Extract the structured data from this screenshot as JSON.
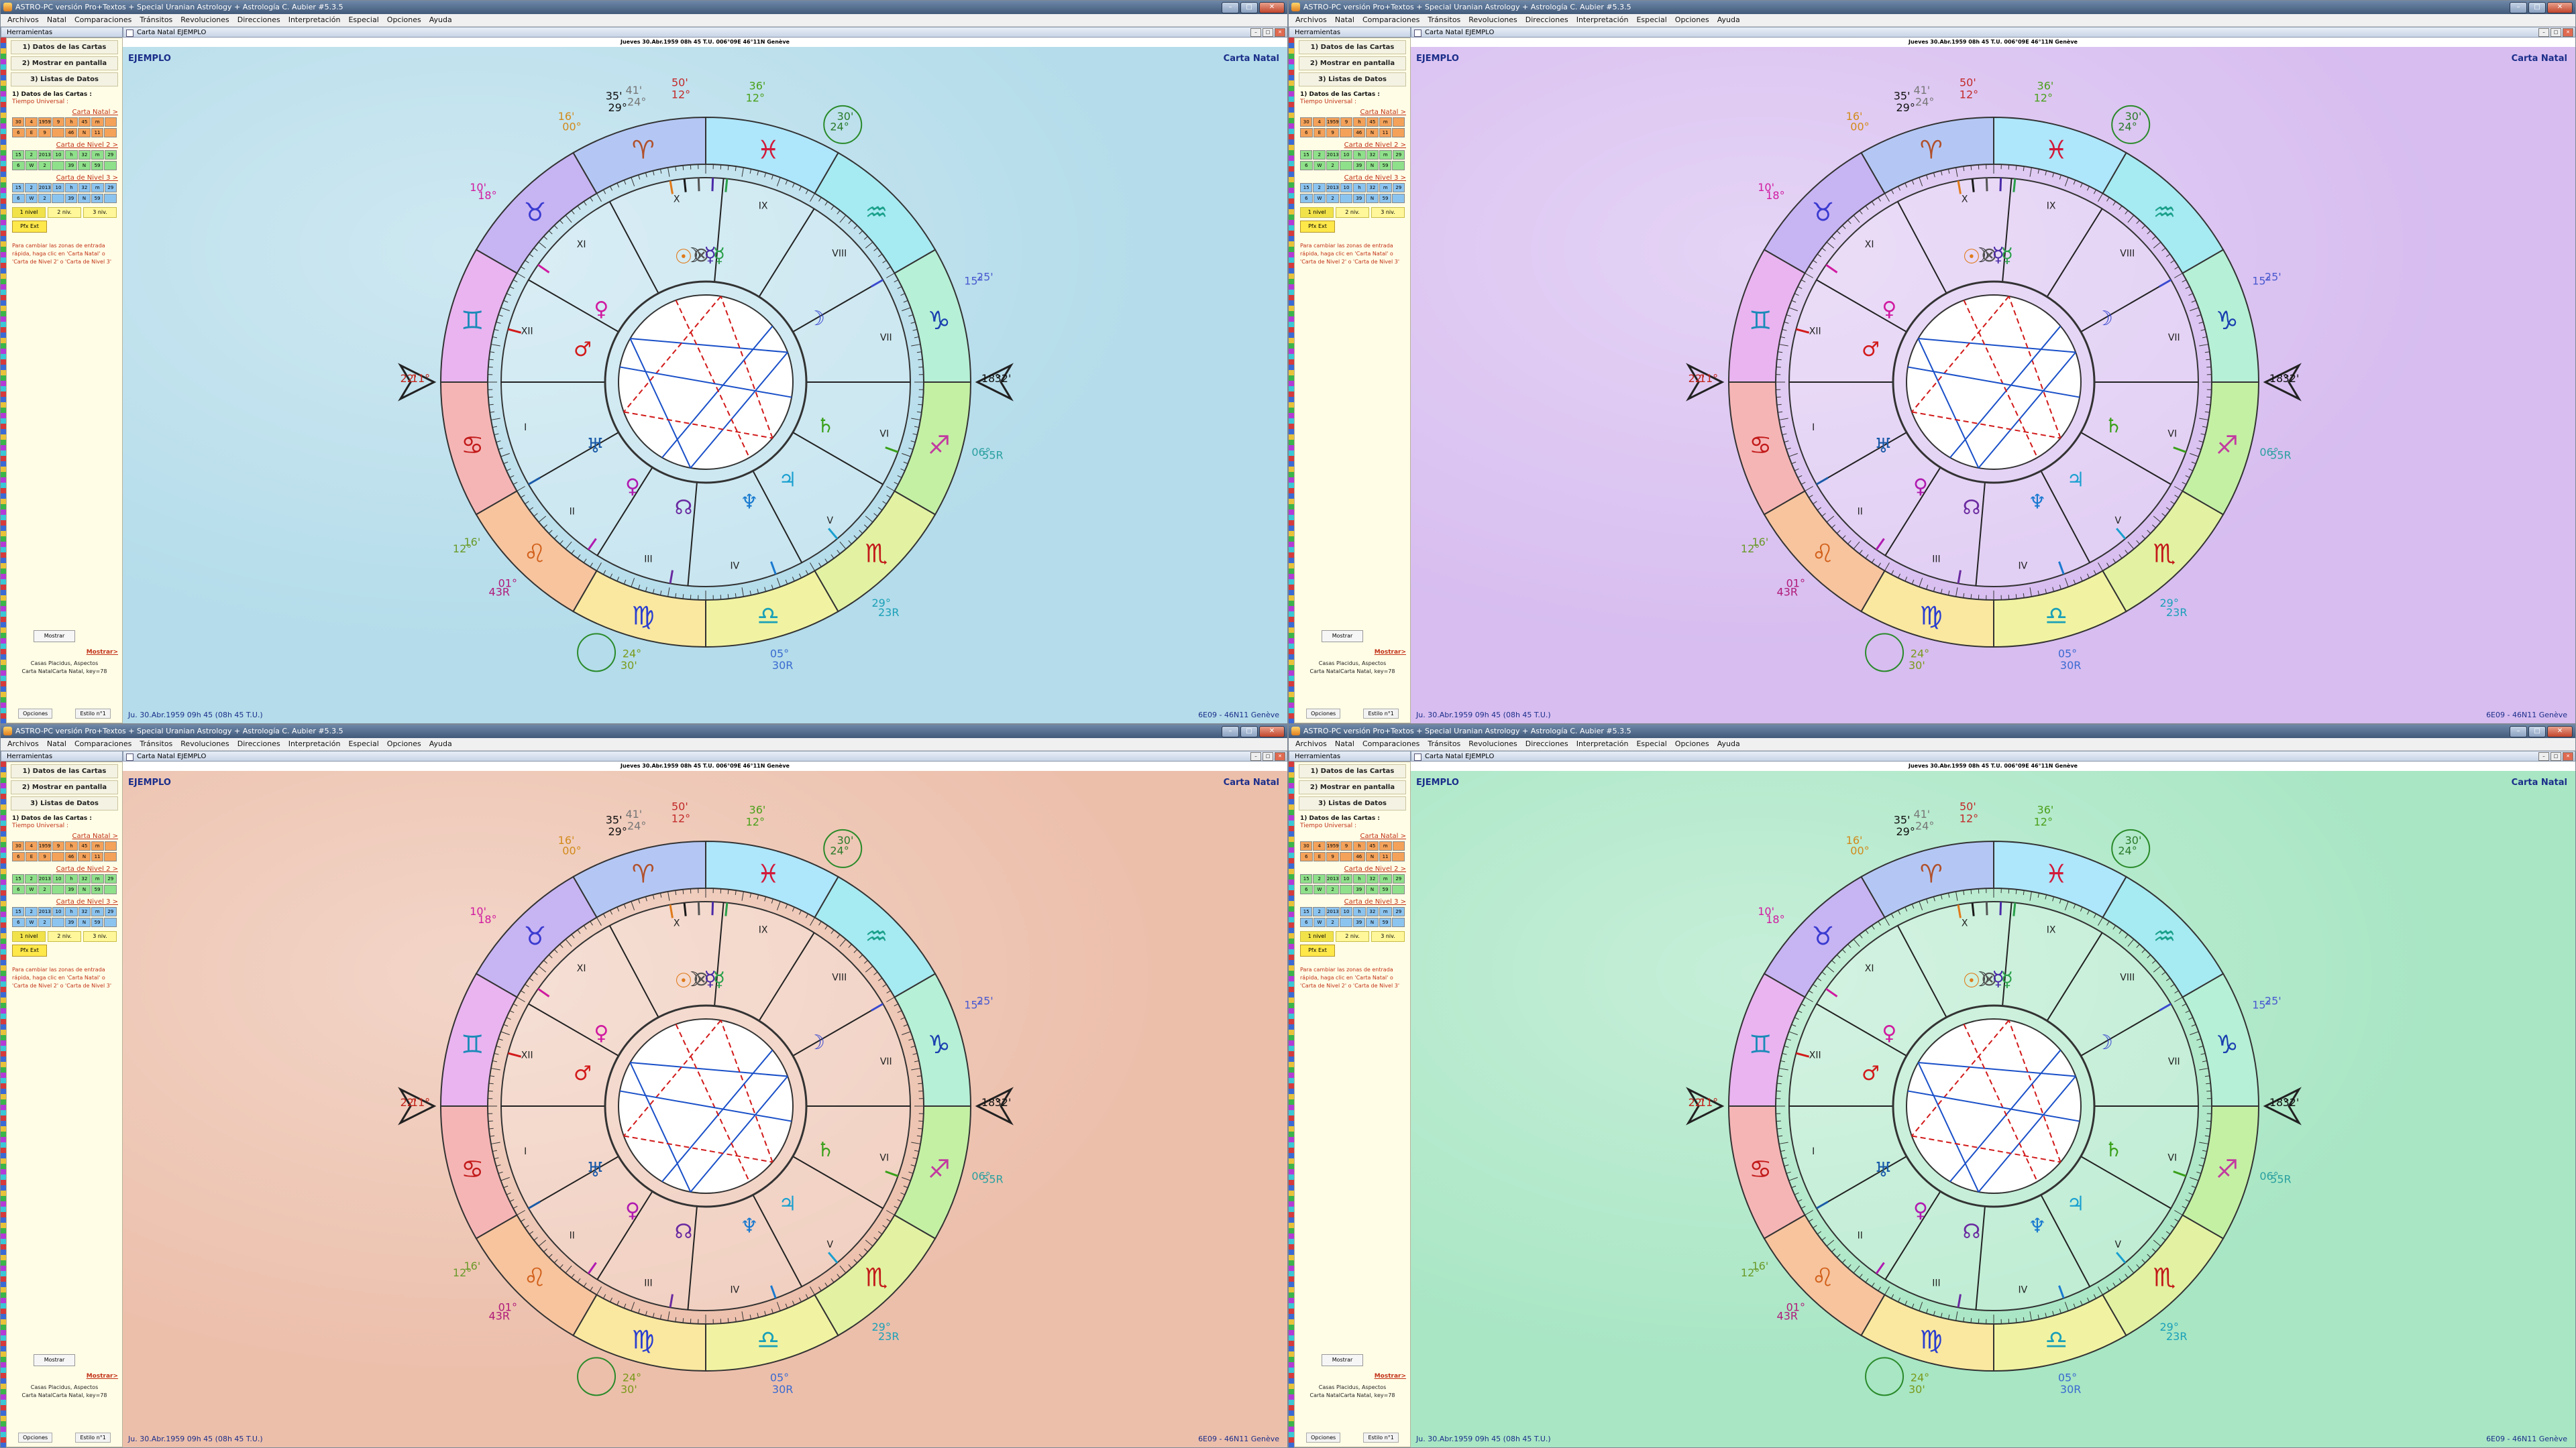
{
  "window": {
    "title": "ASTRO-PC versión Pro+Textos + Special Uranian Astrology + Astrología C. Aubier #5.3.5",
    "controls": {
      "minimize": "–",
      "maximize": "□",
      "close": "✕"
    }
  },
  "menu": [
    "Archivos",
    "Natal",
    "Comparaciones",
    "Tránsitos",
    "Revoluciones",
    "Direcciones",
    "Interpretación",
    "Especial",
    "Opciones",
    "Ayuda"
  ],
  "panel": {
    "header": "Herramientas",
    "buttons": [
      "1) Datos de las Cartas",
      "2) Mostrar en pantalla",
      "3) Listas de Datos"
    ],
    "section_title": "1) Datos de las Cartas :",
    "tiempo": "Tiempo Universal :",
    "natal_head": "Carta Natal >",
    "natal_rows": [
      [
        "30",
        "4",
        "1959",
        "9",
        "h",
        "45",
        "m",
        ""
      ],
      [
        "6",
        "E",
        "9",
        "",
        "46",
        "N",
        "11",
        ""
      ]
    ],
    "nivel2_head": "Carta de Nivel 2 >",
    "nivel2_rows": [
      [
        "15",
        "2",
        "2013",
        "10",
        "h",
        "32",
        "m",
        "29"
      ],
      [
        "6",
        "W",
        "2",
        "",
        "39",
        "N",
        "59",
        ""
      ]
    ],
    "nivel3_head": "Carta de Nivel 3 >",
    "nivel3_rows": [
      [
        "15",
        "2",
        "2013",
        "10",
        "h",
        "32",
        "m",
        "29"
      ],
      [
        "6",
        "W",
        "2",
        "",
        "39",
        "N",
        "59",
        ""
      ]
    ],
    "levels": [
      "1 nivel",
      "2 niv.",
      "3 niv."
    ],
    "pfx": "Pfx Ext",
    "help": "Para cambiar las zonas de entrada rápida, haga clic en 'Carta Natal' o 'Carta de Nivel 2' o 'Carta de Nivel 3'",
    "mostrar_button": "Mostrar",
    "mostrar_link": "Mostrar>",
    "info1": "Casas Placidus, Aspectos",
    "info2": "Carta NatalCarta Natal, key=78",
    "footer": [
      "Opciones",
      "Estilo n°1"
    ]
  },
  "subwindow": {
    "title": "Carta Natal  EJEMPLO",
    "header": "Jueves 30.Abr.1959 08h 45 T.U.  006°09E  46°11N  Genève"
  },
  "chart": {
    "name": "EJEMPLO",
    "type": "Carta Natal",
    "date_line": "Ju. 30.Abr.1959 09h 45 (08h 45 T.U.)",
    "coords": "6E09 - 46N11  Genève",
    "signs": [
      "♈",
      "♉",
      "♊",
      "♋",
      "♌",
      "♍",
      "♎",
      "♏",
      "♐",
      "♑",
      "♒",
      "♓"
    ],
    "houses": [
      "I",
      "II",
      "III",
      "IV",
      "V",
      "VI",
      "VII",
      "VIII",
      "IX",
      "X",
      "XI",
      "XII"
    ],
    "cusp_labels": [
      "12°",
      "50'",
      "24°",
      "41'",
      "29°",
      "35'",
      "00°",
      "16'",
      "18°",
      "10'",
      "11°",
      "22'",
      "16'",
      "12°",
      "01°",
      "43R",
      "24°",
      "30'",
      "05°",
      "30R",
      "29°",
      "23R",
      "06°",
      "55R",
      "18°",
      "32'",
      "15°",
      "25'",
      "24°",
      "30'",
      "12°",
      "36'"
    ]
  },
  "colors": {
    "bg_blue": "#b4dcea",
    "bg_violet": "#d7bdf0",
    "bg_peach": "#ecbfab",
    "bg_green": "#a8e6c4",
    "title": "#1b2e8a"
  }
}
